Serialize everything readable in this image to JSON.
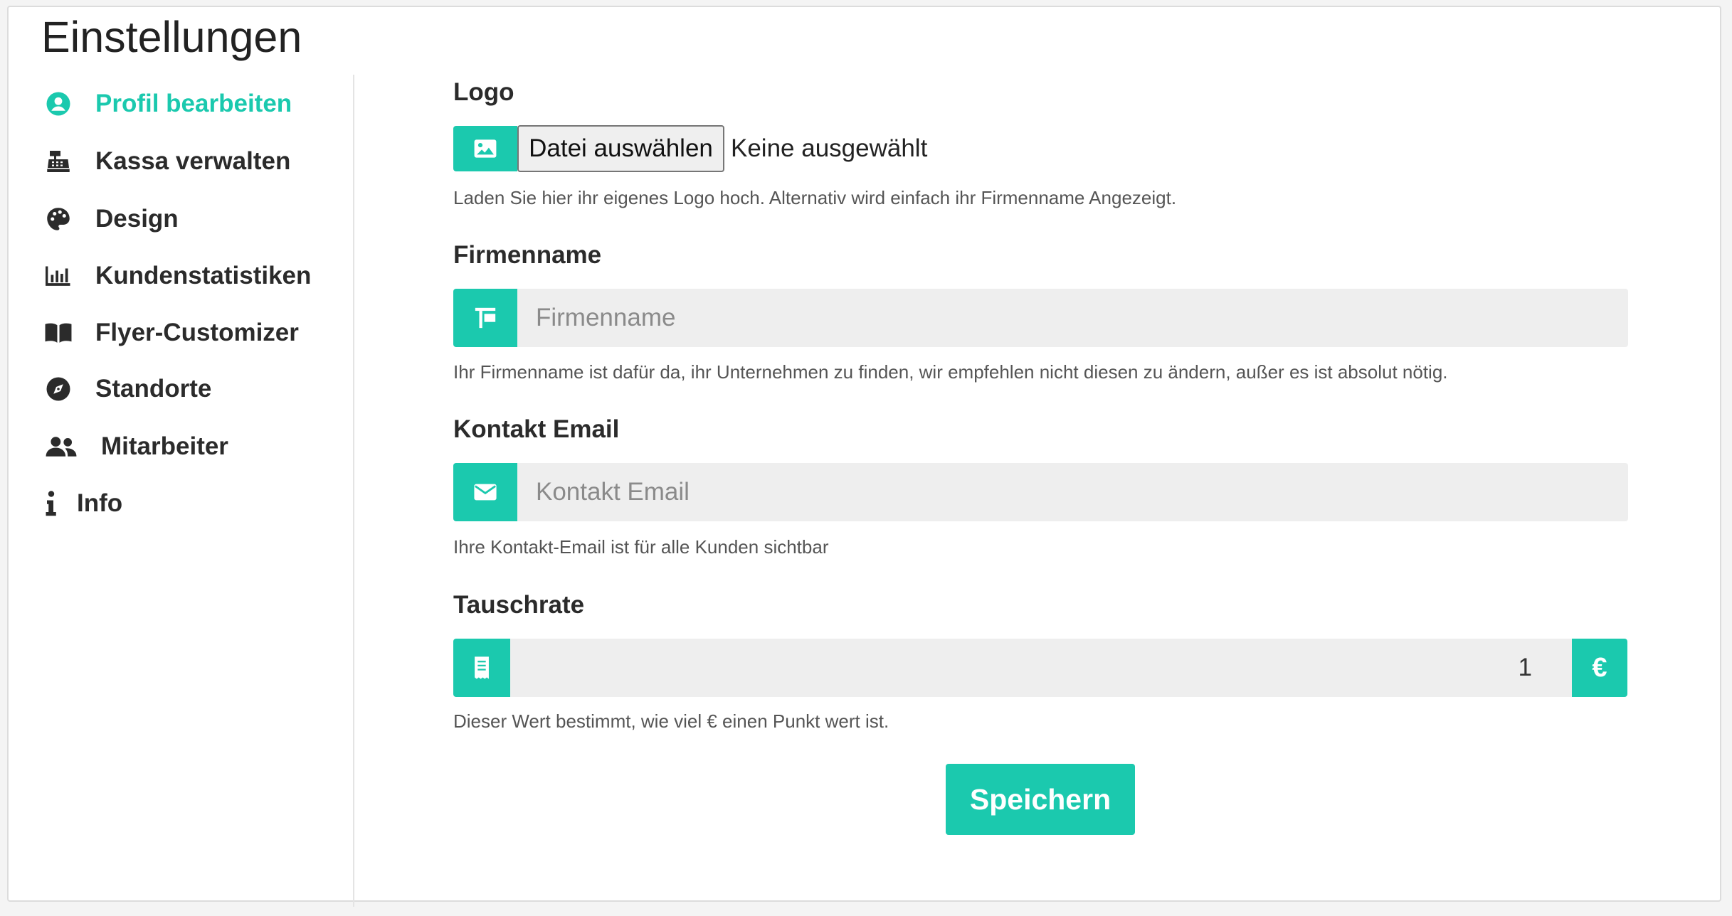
{
  "page": {
    "title": "Einstellungen"
  },
  "sidebar": {
    "items": [
      {
        "label": "Profil bearbeiten",
        "icon": "user-circle-icon",
        "active": true
      },
      {
        "label": "Kassa verwalten",
        "icon": "cash-register-icon"
      },
      {
        "label": "Design",
        "icon": "palette-icon"
      },
      {
        "label": "Kundenstatistiken",
        "icon": "bar-chart-icon"
      },
      {
        "label": "Flyer-Customizer",
        "icon": "book-open-icon"
      },
      {
        "label": "Standorte",
        "icon": "compass-icon"
      },
      {
        "label": "Mitarbeiter",
        "icon": "users-icon"
      },
      {
        "label": "Info",
        "icon": "info-icon"
      }
    ]
  },
  "form": {
    "logo": {
      "label": "Logo",
      "button_label": "Datei auswählen",
      "status": "Keine ausgewählt",
      "help": "Laden Sie hier ihr eigenes Logo hoch. Alternativ wird einfach ihr Firmenname Angezeigt."
    },
    "company": {
      "label": "Firmenname",
      "placeholder": "Firmenname",
      "value": "",
      "help": "Ihr Firmenname ist dafür da, ihr Unternehmen zu finden, wir empfehlen nicht diesen zu ändern, außer es ist absolut nötig."
    },
    "email": {
      "label": "Kontakt Email",
      "placeholder": "Kontakt Email",
      "value": "",
      "help": "Ihre Kontakt-Email ist für alle Kunden sichtbar"
    },
    "rate": {
      "label": "Tauschrate",
      "value": "1",
      "suffix": "€",
      "help": "Dieser Wert bestimmt, wie viel € einen Punkt wert ist."
    },
    "save_label": "Speichern"
  },
  "colors": {
    "accent": "#1bc9ae",
    "input_bg": "#eeeeee"
  }
}
